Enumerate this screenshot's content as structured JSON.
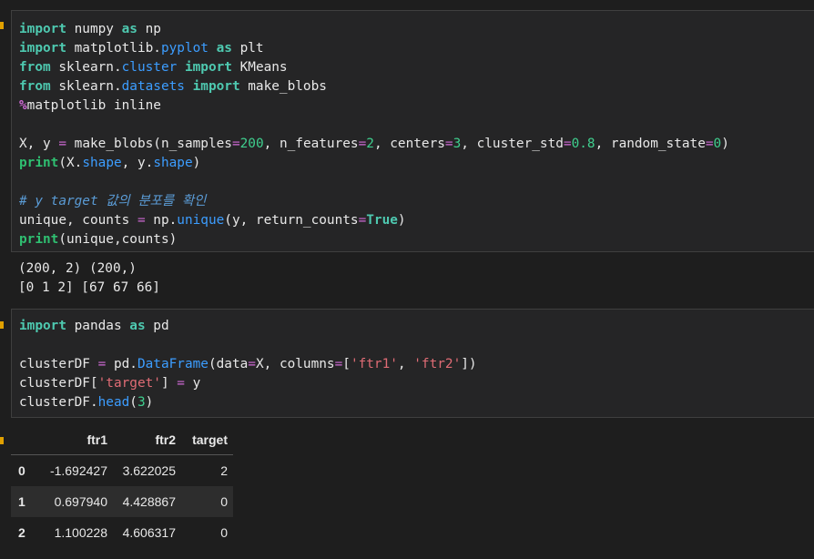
{
  "cell1": {
    "lines": [
      [
        {
          "t": "import",
          "c": "kw"
        },
        {
          "t": " numpy ",
          "c": "txt"
        },
        {
          "t": "as",
          "c": "kw"
        },
        {
          "t": " np",
          "c": "txt"
        }
      ],
      [
        {
          "t": "import",
          "c": "kw"
        },
        {
          "t": " matplotlib.",
          "c": "txt"
        },
        {
          "t": "pyplot",
          "c": "mod"
        },
        {
          "t": " ",
          "c": "txt"
        },
        {
          "t": "as",
          "c": "kw"
        },
        {
          "t": " plt",
          "c": "txt"
        }
      ],
      [
        {
          "t": "from",
          "c": "kw"
        },
        {
          "t": " sklearn.",
          "c": "txt"
        },
        {
          "t": "cluster",
          "c": "mod"
        },
        {
          "t": " ",
          "c": "txt"
        },
        {
          "t": "import",
          "c": "kw"
        },
        {
          "t": " KMeans",
          "c": "txt"
        }
      ],
      [
        {
          "t": "from",
          "c": "kw"
        },
        {
          "t": " sklearn.",
          "c": "txt"
        },
        {
          "t": "datasets",
          "c": "mod"
        },
        {
          "t": " ",
          "c": "txt"
        },
        {
          "t": "import",
          "c": "kw"
        },
        {
          "t": " make_blobs",
          "c": "txt"
        }
      ],
      [
        {
          "t": "%",
          "c": "magic-pct"
        },
        {
          "t": "matplotlib inline",
          "c": "txt"
        }
      ],
      [],
      [
        {
          "t": "X, y ",
          "c": "txt"
        },
        {
          "t": "=",
          "c": "op"
        },
        {
          "t": " make_blobs(n_samples",
          "c": "txt"
        },
        {
          "t": "=",
          "c": "op"
        },
        {
          "t": "200",
          "c": "num"
        },
        {
          "t": ", n_features",
          "c": "txt"
        },
        {
          "t": "=",
          "c": "op"
        },
        {
          "t": "2",
          "c": "num"
        },
        {
          "t": ", centers",
          "c": "txt"
        },
        {
          "t": "=",
          "c": "op"
        },
        {
          "t": "3",
          "c": "num"
        },
        {
          "t": ", cluster_std",
          "c": "txt"
        },
        {
          "t": "=",
          "c": "op"
        },
        {
          "t": "0.8",
          "c": "num"
        },
        {
          "t": ", random_state",
          "c": "txt"
        },
        {
          "t": "=",
          "c": "op"
        },
        {
          "t": "0",
          "c": "num"
        },
        {
          "t": ")",
          "c": "txt"
        }
      ],
      [
        {
          "t": "print",
          "c": "kw2"
        },
        {
          "t": "(X.",
          "c": "txt"
        },
        {
          "t": "shape",
          "c": "mod"
        },
        {
          "t": ", y.",
          "c": "txt"
        },
        {
          "t": "shape",
          "c": "mod"
        },
        {
          "t": ")",
          "c": "txt"
        }
      ],
      [],
      [
        {
          "t": "# y target 값의 분포를 확인",
          "c": "cmt"
        }
      ],
      [
        {
          "t": "unique, counts ",
          "c": "txt"
        },
        {
          "t": "=",
          "c": "op"
        },
        {
          "t": " np.",
          "c": "txt"
        },
        {
          "t": "unique",
          "c": "fn"
        },
        {
          "t": "(y, return_counts",
          "c": "txt"
        },
        {
          "t": "=",
          "c": "op"
        },
        {
          "t": "True",
          "c": "kw"
        },
        {
          "t": ")",
          "c": "txt"
        }
      ],
      [
        {
          "t": "print",
          "c": "kw2"
        },
        {
          "t": "(unique,counts)",
          "c": "txt"
        }
      ]
    ]
  },
  "output1": {
    "lines": [
      "(200, 2) (200,)",
      "[0 1 2] [67 67 66]"
    ]
  },
  "cell2": {
    "lines": [
      [
        {
          "t": "import",
          "c": "kw"
        },
        {
          "t": " pandas ",
          "c": "txt"
        },
        {
          "t": "as",
          "c": "kw"
        },
        {
          "t": " pd",
          "c": "txt"
        }
      ],
      [],
      [
        {
          "t": "clusterDF ",
          "c": "txt"
        },
        {
          "t": "=",
          "c": "op"
        },
        {
          "t": " pd.",
          "c": "txt"
        },
        {
          "t": "DataFrame",
          "c": "mod"
        },
        {
          "t": "(data",
          "c": "txt"
        },
        {
          "t": "=",
          "c": "op"
        },
        {
          "t": "X, columns",
          "c": "txt"
        },
        {
          "t": "=",
          "c": "op"
        },
        {
          "t": "[",
          "c": "txt"
        },
        {
          "t": "'ftr1'",
          "c": "str"
        },
        {
          "t": ", ",
          "c": "txt"
        },
        {
          "t": "'ftr2'",
          "c": "str"
        },
        {
          "t": "])",
          "c": "txt"
        }
      ],
      [
        {
          "t": "clusterDF[",
          "c": "txt"
        },
        {
          "t": "'target'",
          "c": "str"
        },
        {
          "t": "] ",
          "c": "txt"
        },
        {
          "t": "=",
          "c": "op"
        },
        {
          "t": " y",
          "c": "txt"
        }
      ],
      [
        {
          "t": "clusterDF.",
          "c": "txt"
        },
        {
          "t": "head",
          "c": "fn"
        },
        {
          "t": "(",
          "c": "txt"
        },
        {
          "t": "3",
          "c": "num"
        },
        {
          "t": ")",
          "c": "txt"
        }
      ]
    ]
  },
  "dataframe": {
    "columns": [
      "",
      "ftr1",
      "ftr2",
      "target"
    ],
    "rows": [
      {
        "index": "0",
        "ftr1": "-1.692427",
        "ftr2": "3.622025",
        "target": "2"
      },
      {
        "index": "1",
        "ftr1": "0.697940",
        "ftr2": "4.428867",
        "target": "0"
      },
      {
        "index": "2",
        "ftr1": "1.100228",
        "ftr2": "4.606317",
        "target": "0"
      }
    ]
  }
}
